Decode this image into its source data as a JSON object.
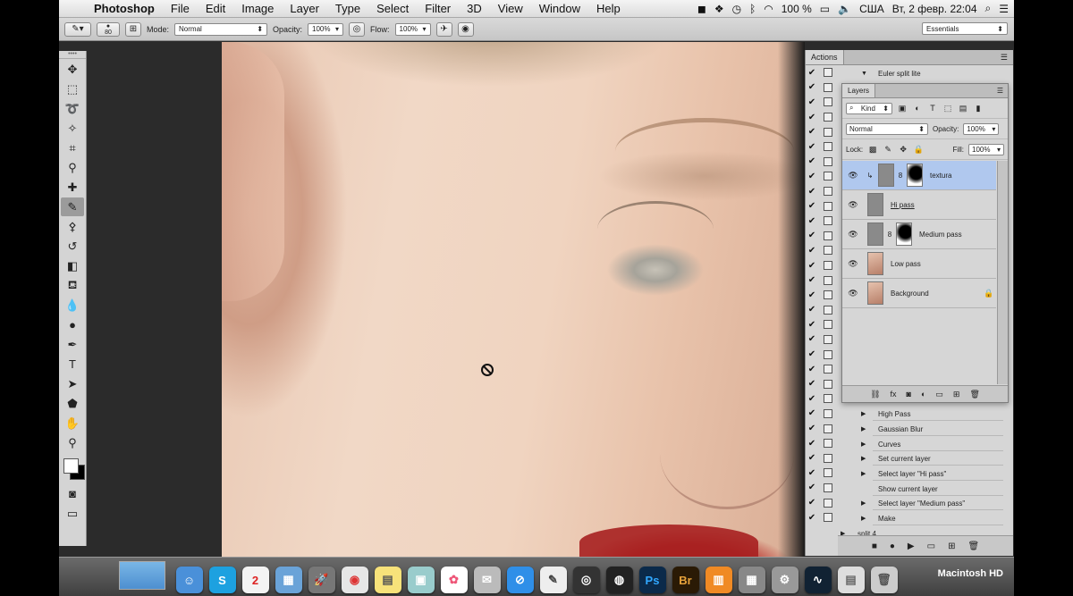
{
  "menubar": {
    "app_name": "Photoshop",
    "menus": [
      "File",
      "Edit",
      "Image",
      "Layer",
      "Type",
      "Select",
      "Filter",
      "3D",
      "View",
      "Window",
      "Help"
    ],
    "battery": "100 %",
    "input_source": "США",
    "datetime": "Вт, 2 февр.  22:04"
  },
  "options": {
    "brush_size": "80",
    "mode_label": "Mode:",
    "mode_value": "Normal",
    "opacity_label": "Opacity:",
    "opacity_value": "100%",
    "flow_label": "Flow:",
    "flow_value": "100%",
    "workspace": "Essentials"
  },
  "actions_panel": {
    "tab": "Actions",
    "top_item": "Euler split lite",
    "items": [
      "High Pass",
      "Gaussian Blur",
      "Curves",
      "Set current layer",
      "Select layer \"Hi pass\"",
      "Show current layer",
      "Select layer \"Medium pass\"",
      "Make"
    ],
    "bottom_item": "split 4"
  },
  "layers_panel": {
    "tab": "Layers",
    "filter_kind": "Kind",
    "blend_mode": "Normal",
    "opacity_label": "Opacity:",
    "opacity_value": "100%",
    "lock_label": "Lock:",
    "fill_label": "Fill:",
    "fill_value": "100%",
    "layers": [
      {
        "name": "textura",
        "selected": true
      },
      {
        "name": "Hi pass",
        "selected": false
      },
      {
        "name": "Medium pass",
        "selected": false
      },
      {
        "name": "Low pass",
        "selected": false
      },
      {
        "name": "Background",
        "selected": false
      }
    ]
  },
  "dock": {
    "drive_label": "Macintosh HD",
    "calendar_day": "2",
    "photoshop_label": "Ps",
    "bridge_label": "Br",
    "skype_label": "S"
  },
  "colors": {
    "selected_layer": "#b0c8ee",
    "panel_bg": "#d6d6d6",
    "lip_red": "#a72020"
  }
}
